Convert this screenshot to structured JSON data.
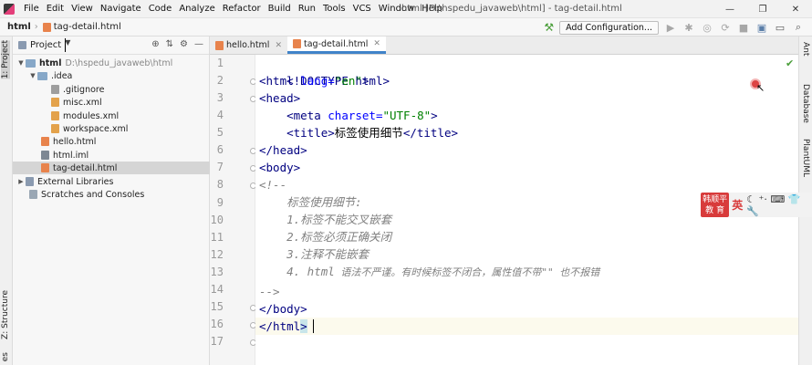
{
  "menu": [
    "File",
    "Edit",
    "View",
    "Navigate",
    "Code",
    "Analyze",
    "Refactor",
    "Build",
    "Run",
    "Tools",
    "VCS",
    "Window",
    "Help"
  ],
  "window_title": "html [D:\\hspedu_javaweb\\html] - tag-detail.html",
  "nav": {
    "breadcrumb_project": "html",
    "breadcrumb_file": "tag-detail.html",
    "add_config_label": "Add Configuration..."
  },
  "left_tabs": {
    "project": "1: Project",
    "structure": "Z: Structure",
    "favorites": "es"
  },
  "right_tabs": {
    "ant": "Ant",
    "database": "Database",
    "plantuml": "PlantUML"
  },
  "project_panel": {
    "title": "Project",
    "tree": [
      {
        "name": "html",
        "note": "D:\\hspedu_javaweb\\html",
        "icon": "folder-icon"
      },
      {
        "name": ".idea",
        "icon": "folder-icon"
      },
      {
        "name": ".gitignore",
        "icon": "gitignore-file-icon"
      },
      {
        "name": "misc.xml",
        "icon": "xml-file-icon"
      },
      {
        "name": "modules.xml",
        "icon": "xml-file-icon"
      },
      {
        "name": "workspace.xml",
        "icon": "xml-file-icon"
      },
      {
        "name": "hello.html",
        "icon": "html-file-icon"
      },
      {
        "name": "html.iml",
        "icon": "iml-file-icon"
      },
      {
        "name": "tag-detail.html",
        "icon": "html-file-icon",
        "selected": true
      },
      {
        "name": "External Libraries",
        "icon": "libraries-icon"
      },
      {
        "name": "Scratches and Consoles",
        "icon": "scratches-icon"
      }
    ]
  },
  "tabs": [
    {
      "label": "hello.html",
      "active": false
    },
    {
      "label": "tag-detail.html",
      "active": true
    }
  ],
  "line_numbers": [
    "1",
    "2",
    "3",
    "4",
    "5",
    "6",
    "7",
    "8",
    "9",
    "10",
    "11",
    "12",
    "13",
    "14",
    "15",
    "16",
    "17"
  ],
  "code": {
    "l1": "<!DOCTYPE html>",
    "l2_tag_open": "<html ",
    "l2_attr": "lang=",
    "l2_val": "\"en\"",
    "l2_close": ">",
    "l3": "<head>",
    "l4_indent": "    ",
    "l4_tag": "<meta ",
    "l4_attr": "charset=",
    "l4_val": "\"UTF-8\"",
    "l4_close": ">",
    "l5_tag_open": "<title>",
    "l5_text": "标签使用细节",
    "l5_tag_close": "</title>",
    "l6": "</head>",
    "l7": "<body>",
    "l8": "<!--",
    "l9": "标签使用细节:",
    "l10": "1.标签不能交叉嵌套",
    "l11": "2.标签必须正确关闭",
    "l12": "3.注释不能嵌套",
    "l13_a": "4. html",
    "l13_b": " 语法不严谨。有时候标签不闭合，属性值不带\"\" 也不报错",
    "l15": "-->",
    "l16": "</body>",
    "l17a": "</html",
    "l17b": ">"
  },
  "ime_widget": {
    "logo_line1": "韩顺平",
    "logo_line2": "教 育",
    "lang": "英",
    "extra": "☾ ⁺·  ⌨ 👕 🔧"
  }
}
